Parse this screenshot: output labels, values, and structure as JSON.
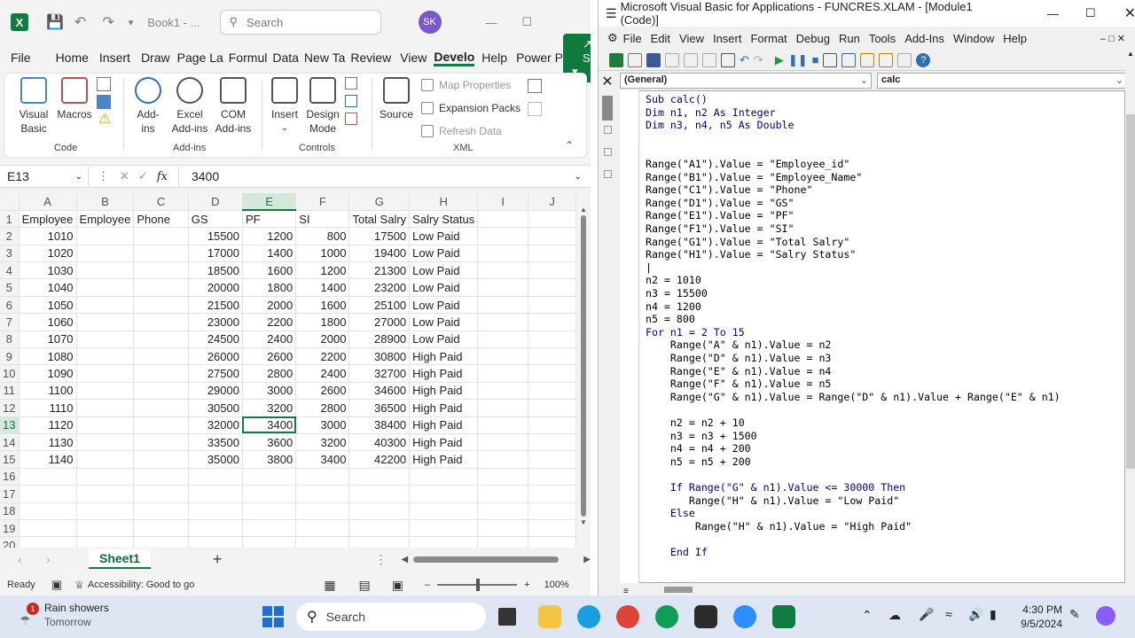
{
  "excel": {
    "title_doc": "Book1 - ...",
    "search_placeholder": "Search",
    "user_initials": "SK",
    "tabs": [
      "File",
      "Home",
      "Insert",
      "Draw",
      "Page La",
      "Formul",
      "Data",
      "New Ta",
      "Review",
      "View",
      "Develo",
      "Help",
      "Power P"
    ],
    "share_label": "Share",
    "ribbon": {
      "visual_basic": "Visual Basic",
      "macros": "Macros",
      "code_group": "Code",
      "add_ins": "Add-ins",
      "excel_add_ins": "Excel Add-ins",
      "com_add_ins": "COM Add-ins",
      "addins_group": "Add-ins",
      "insert": "Insert",
      "design_mode": "Design Mode",
      "controls_group": "Controls",
      "source": "Source",
      "map_properties": "Map Properties",
      "expansion_packs": "Expansion Packs",
      "refresh_data": "Refresh Data",
      "xml_group": "XML"
    },
    "name_box": "E13",
    "formula_value": "3400",
    "columns": [
      "A",
      "B",
      "C",
      "D",
      "E",
      "F",
      "G",
      "H",
      "I",
      "J"
    ],
    "header_row": [
      "Employee",
      "Employee",
      "Phone",
      "GS",
      "PF",
      "SI",
      "Total Salry",
      "Salry Status"
    ],
    "rows": [
      [
        "1010",
        "",
        "",
        "15500",
        "1200",
        "800",
        "17500",
        "Low Paid"
      ],
      [
        "1020",
        "",
        "",
        "17000",
        "1400",
        "1000",
        "19400",
        "Low Paid"
      ],
      [
        "1030",
        "",
        "",
        "18500",
        "1600",
        "1200",
        "21300",
        "Low Paid"
      ],
      [
        "1040",
        "",
        "",
        "20000",
        "1800",
        "1400",
        "23200",
        "Low Paid"
      ],
      [
        "1050",
        "",
        "",
        "21500",
        "2000",
        "1600",
        "25100",
        "Low Paid"
      ],
      [
        "1060",
        "",
        "",
        "23000",
        "2200",
        "1800",
        "27000",
        "Low Paid"
      ],
      [
        "1070",
        "",
        "",
        "24500",
        "2400",
        "2000",
        "28900",
        "Low Paid"
      ],
      [
        "1080",
        "",
        "",
        "26000",
        "2600",
        "2200",
        "30800",
        "High Paid"
      ],
      [
        "1090",
        "",
        "",
        "27500",
        "2800",
        "2400",
        "32700",
        "High Paid"
      ],
      [
        "1100",
        "",
        "",
        "29000",
        "3000",
        "2600",
        "34600",
        "High Paid"
      ],
      [
        "1110",
        "",
        "",
        "30500",
        "3200",
        "2800",
        "36500",
        "High Paid"
      ],
      [
        "1120",
        "",
        "",
        "32000",
        "3400",
        "3000",
        "38400",
        "High Paid"
      ],
      [
        "1130",
        "",
        "",
        "33500",
        "3600",
        "3200",
        "40300",
        "High Paid"
      ],
      [
        "1140",
        "",
        "",
        "35000",
        "3800",
        "3400",
        "42200",
        "High Paid"
      ]
    ],
    "row_numbers": [
      "1",
      "2",
      "3",
      "4",
      "5",
      "6",
      "7",
      "8",
      "9",
      "10",
      "11",
      "12",
      "13",
      "14",
      "15",
      "16",
      "17",
      "18",
      "19",
      "20"
    ],
    "sheet_tab": "Sheet1",
    "status_ready": "Ready",
    "status_accessibility": "Accessibility: Good to go",
    "zoom": "100%"
  },
  "vba": {
    "title": "Microsoft Visual Basic for Applications - FUNCRES.XLAM - [Module1 (Code)]",
    "menu": [
      "File",
      "Edit",
      "View",
      "Insert",
      "Format",
      "Debug",
      "Run",
      "Tools",
      "Add-Ins",
      "Window",
      "Help"
    ],
    "combo_object": "(General)",
    "combo_proc": "calc",
    "code_lines": [
      "Sub calc()",
      "Dim n1, n2 As Integer",
      "Dim n3, n4, n5 As Double",
      "",
      "",
      "Range(\"A1\").Value = \"Employee_id\"",
      "Range(\"B1\").Value = \"Employee_Name\"",
      "Range(\"C1\").Value = \"Phone\"",
      "Range(\"D1\").Value = \"GS\"",
      "Range(\"E1\").Value = \"PF\"",
      "Range(\"F1\").Value = \"SI\"",
      "Range(\"G1\").Value = \"Total Salry\"",
      "Range(\"H1\").Value = \"Salry Status\"",
      "|",
      "n2 = 1010",
      "n3 = 15500",
      "n4 = 1200",
      "n5 = 800",
      "For n1 = 2 To 15",
      "    Range(\"A\" & n1).Value = n2",
      "    Range(\"D\" & n1).Value = n3",
      "    Range(\"E\" & n1).Value = n4",
      "    Range(\"F\" & n1).Value = n5",
      "    Range(\"G\" & n1).Value = Range(\"D\" & n1).Value + Range(\"E\" & n1)",
      "",
      "    n2 = n2 + 10",
      "    n3 = n3 + 1500",
      "    n4 = n4 + 200",
      "    n5 = n5 + 200",
      "",
      "    If Range(\"G\" & n1).Value <= 30000 Then",
      "       Range(\"H\" & n1).Value = \"Low Paid\"",
      "    Else",
      "        Range(\"H\" & n1).Value = \"High Paid\"",
      "",
      "    End If"
    ]
  },
  "taskbar": {
    "weather_badge": "1",
    "weather_title": "Rain showers",
    "weather_sub": "Tomorrow",
    "search_label": "Search",
    "time": "4:30 PM",
    "date": "9/5/2024"
  }
}
